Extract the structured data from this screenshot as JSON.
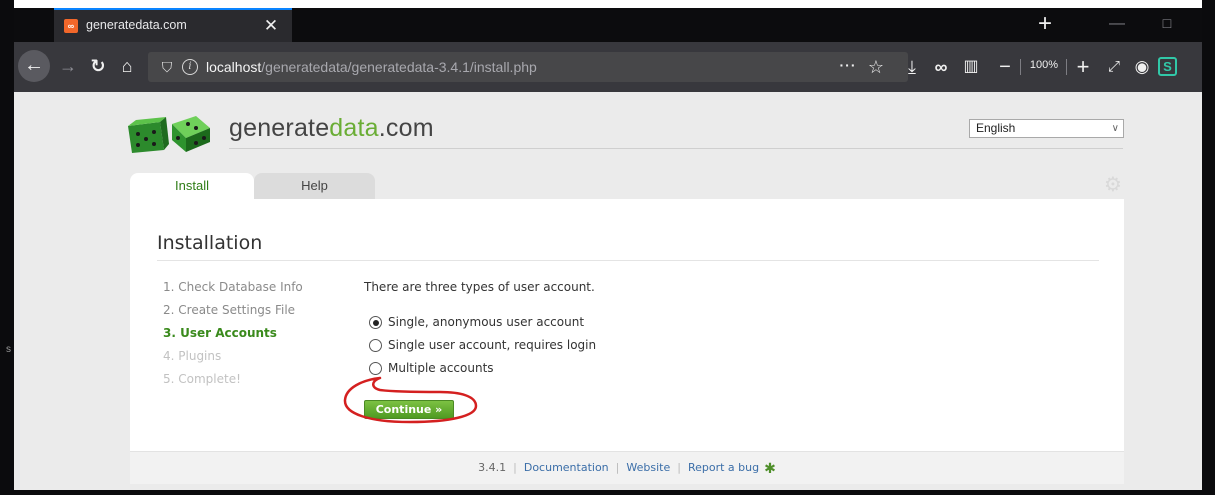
{
  "browser": {
    "tab_title": "generatedata.com",
    "tab_favicon_glyph": "∞",
    "tab_close_glyph": "✕",
    "new_tab_glyph": "+",
    "minimize_glyph": "—",
    "maximize_glyph": "☐",
    "url_host": "localhost",
    "url_path": "/generatedata/generatedata-3.4.1/install.php",
    "url_info_glyph": "i",
    "more_glyph": "···",
    "star_glyph": "☆",
    "zoom_level": "100%",
    "extension_glyph": "S",
    "accent_color": "#0a84ff"
  },
  "site": {
    "logo_text_main": "generate",
    "logo_text_accent": "data",
    "logo_text_suffix": ".com",
    "language_selected": "English",
    "accent_color": "#6aad35"
  },
  "tabs": {
    "install": "Install",
    "help": "Help"
  },
  "installation": {
    "title": "Installation",
    "steps": [
      {
        "label": "1. Check Database Info",
        "state": "done"
      },
      {
        "label": "2. Create Settings File",
        "state": "done"
      },
      {
        "label": "3. User Accounts",
        "state": "active"
      },
      {
        "label": "4. Plugins",
        "state": "future"
      },
      {
        "label": "5. Complete!",
        "state": "future"
      }
    ],
    "intro": "There are three types of user account.",
    "options": [
      {
        "label": "Single, anonymous user account",
        "checked": true
      },
      {
        "label": "Single user account, requires login",
        "checked": false
      },
      {
        "label": "Multiple accounts",
        "checked": false
      }
    ],
    "continue_label": "Continue »",
    "annotation_color": "#d42020"
  },
  "footer": {
    "version": "3.4.1",
    "documentation": "Documentation",
    "website": "Website",
    "report_bug": "Report a bug",
    "separator": "|"
  },
  "edge_char": "s"
}
